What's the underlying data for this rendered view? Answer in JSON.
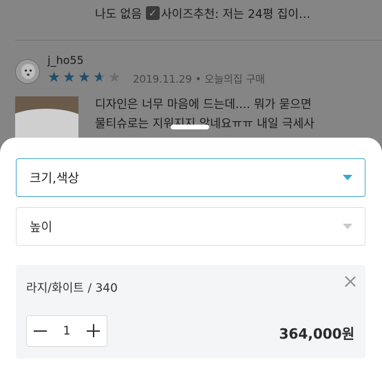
{
  "review_background": {
    "prev_review_text": "나도 없음",
    "prev_review_check": "✓",
    "prev_review_text2": "사이즈추천:  저는 24평 집이…",
    "username": "j_ho55",
    "rating": 3.5,
    "date": "2019.11.29 • 오늘의집 구매",
    "review_line1": "디자인은 너무 마음에 드는데.... 뭐가 묻으면",
    "review_line2": "물티슈로는 지워지지 않네요ㅠㅠ 내일 극세사"
  },
  "option_sheet": {
    "select1_label": "크기,색상",
    "select2_label": "높이",
    "selected_option": {
      "name": "라지/화이트 / 340",
      "quantity": "1",
      "price": "364,000원"
    }
  },
  "colors": {
    "accent": "#3aa6d0",
    "star": "#1f4e6a"
  }
}
